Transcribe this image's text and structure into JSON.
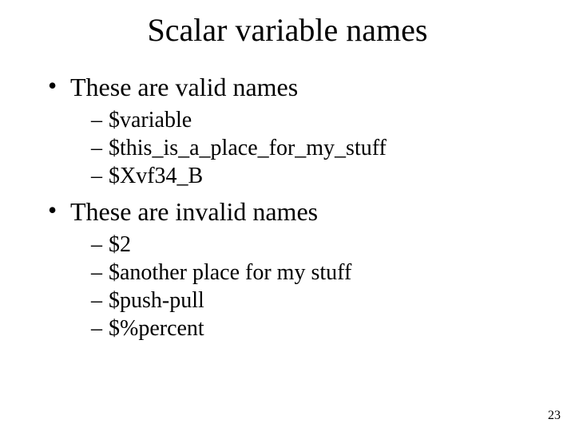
{
  "title": "Scalar variable names",
  "bullets": [
    {
      "text": "These are valid names",
      "sub": [
        "$variable",
        "$this_is_a_place_for_my_stuff",
        "$Xvf34_B"
      ]
    },
    {
      "text": "These are invalid names",
      "sub": [
        "$2",
        "$another place for my stuff",
        "$push-pull",
        "$%percent"
      ]
    }
  ],
  "page_number": "23"
}
